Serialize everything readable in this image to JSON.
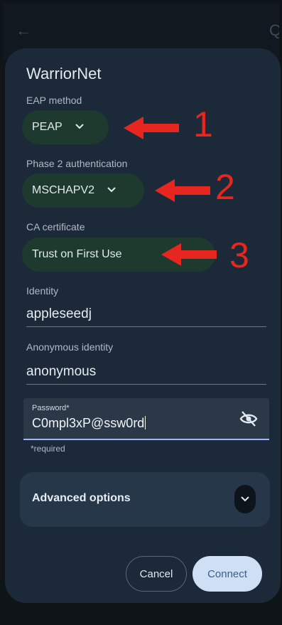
{
  "dialog": {
    "title": "WarriorNet",
    "eap_method": {
      "label": "EAP method",
      "value": "PEAP"
    },
    "phase2": {
      "label": "Phase 2 authentication",
      "value": "MSCHAPV2"
    },
    "ca_certificate": {
      "label": "CA certificate",
      "value": "Trust on First Use"
    },
    "identity": {
      "label": "Identity",
      "value": "appleseedj"
    },
    "anonymous_identity": {
      "label": "Anonymous identity",
      "value": "anonymous"
    },
    "password": {
      "label": "Password*",
      "value": "C0mpl3xP@ssw0rd",
      "helper": "*required"
    },
    "advanced": {
      "label": "Advanced options"
    },
    "buttons": {
      "cancel": "Cancel",
      "connect": "Connect"
    }
  },
  "annotations": [
    {
      "number": "1"
    },
    {
      "number": "2"
    },
    {
      "number": "3"
    }
  ],
  "colors": {
    "dialog_bg": "#1c2938",
    "pill_bg": "#1e3a2e",
    "arrow_red": "#e6261f",
    "accent": "#9db6ff",
    "connect_bg": "#cfe0f4"
  }
}
